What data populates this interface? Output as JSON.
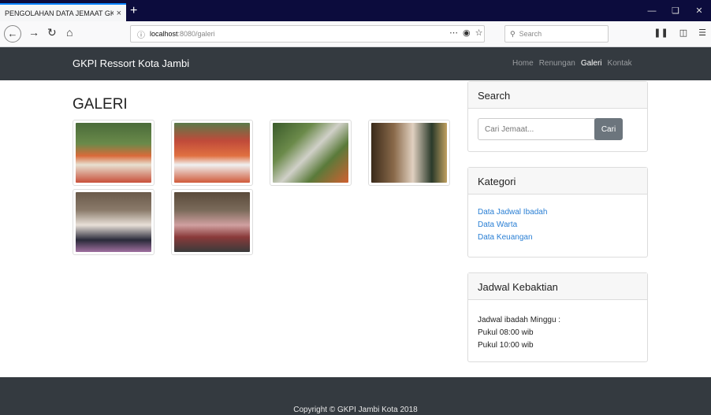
{
  "browser": {
    "tab_title": "PENGOLAHAN DATA JEMAAT GKPI",
    "tab_close": "×",
    "new_tab": "+",
    "url_host": "localhost",
    "url_path": ":8080/galeri",
    "search_placeholder": "Search"
  },
  "site": {
    "brand": "GKPI Ressort Kota Jambi",
    "nav": [
      {
        "label": "Home"
      },
      {
        "label": "Renungan"
      },
      {
        "label": "Galeri"
      },
      {
        "label": "Kontak"
      }
    ]
  },
  "main": {
    "title": "GALERI"
  },
  "sidebar": {
    "search": {
      "header": "Search",
      "placeholder": "Cari Jemaat...",
      "button": "Cari"
    },
    "kategori": {
      "header": "Kategori",
      "links": [
        "Data Jadwal Ibadah",
        "Data Warta",
        "Data Keuangan"
      ]
    },
    "jadwal": {
      "header": "Jadwal Kebaktian",
      "lines": [
        "Jadwal ibadah Minggu :",
        "Pukul 08:00 wib",
        "Pukul 10:00 wib"
      ]
    }
  },
  "footer": {
    "copyright": "Copyright © GKPI Jambi Kota 2018"
  },
  "colors": {
    "navbar_bg": "#343a40",
    "link": "#2a7fd4",
    "button": "#6c757d"
  }
}
